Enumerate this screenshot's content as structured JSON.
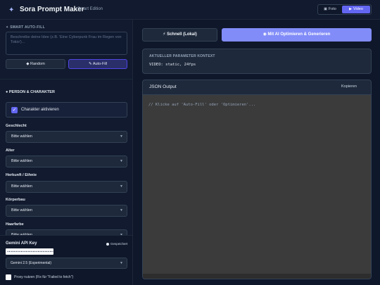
{
  "header": {
    "app_title": "Sora Prompt Maker",
    "subtitle": "Smart Edition",
    "modes": [
      {
        "label": "Foto",
        "icon": "image-icon"
      },
      {
        "label": "Video",
        "icon": "video-icon",
        "active": true
      }
    ]
  },
  "sidebar": {
    "autofill_label": "SMART AUTO-FILL",
    "idea_placeholder": "Beschreibe deine Idee (z.B. 'Eine Cyberpunk Frau im Regen von Tokio')...",
    "random_button": "Random",
    "autofill_button": "Auto-Fill",
    "person_section": "PERSON & CHARAKTER",
    "character_toggle": "Charakter aktivieren",
    "character_checked": true,
    "fields": [
      {
        "label": "Geschlecht",
        "value": "Bitte wählen"
      },
      {
        "label": "Alter",
        "value": "Bitte wählen"
      },
      {
        "label": "Herkunft / Ethnie",
        "value": "Bitte wählen"
      },
      {
        "label": "Körperbau",
        "value": "Bitte wählen"
      },
      {
        "label": "Haarfarbe",
        "value": "Bitte wählen"
      }
    ],
    "api": {
      "label": "Gemini API Key",
      "saved_label": "Gespeichert",
      "key_masked": "••••••••••••••••••••••••••••••••",
      "model": "Gemini 2.5 (Experimental)",
      "proxy_label": "Proxy nutzen (Fix für \"Failed to fetch\")",
      "proxy_checked": false
    }
  },
  "main": {
    "local_button": "Schnell (Lokal)",
    "ai_button": "Mit AI Optimieren & Generieren",
    "context_title": "AKTUELLER PARAMETER KONTEXT",
    "context_value": "VIDEO: static, 24fps",
    "json_title": "JSON Output",
    "copy_button": "Kopieren",
    "json_placeholder": "// Klicke auf 'Auto-Fill' oder 'Optimieren'..."
  },
  "colors": {
    "accent": "#6366f1",
    "primary_button": "#818cf8",
    "background": "#0f172a"
  }
}
